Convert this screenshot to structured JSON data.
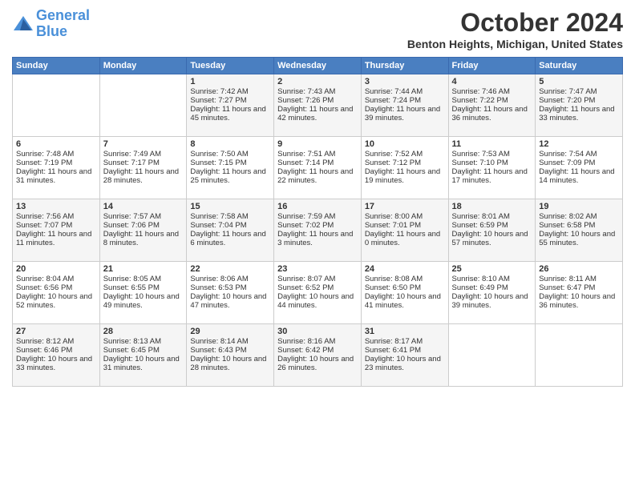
{
  "logo": {
    "line1": "General",
    "line2": "Blue"
  },
  "title": "October 2024",
  "location": "Benton Heights, Michigan, United States",
  "days_of_week": [
    "Sunday",
    "Monday",
    "Tuesday",
    "Wednesday",
    "Thursday",
    "Friday",
    "Saturday"
  ],
  "weeks": [
    [
      {
        "day": "",
        "sunrise": "",
        "sunset": "",
        "daylight": ""
      },
      {
        "day": "",
        "sunrise": "",
        "sunset": "",
        "daylight": ""
      },
      {
        "day": "1",
        "sunrise": "Sunrise: 7:42 AM",
        "sunset": "Sunset: 7:27 PM",
        "daylight": "Daylight: 11 hours and 45 minutes."
      },
      {
        "day": "2",
        "sunrise": "Sunrise: 7:43 AM",
        "sunset": "Sunset: 7:26 PM",
        "daylight": "Daylight: 11 hours and 42 minutes."
      },
      {
        "day": "3",
        "sunrise": "Sunrise: 7:44 AM",
        "sunset": "Sunset: 7:24 PM",
        "daylight": "Daylight: 11 hours and 39 minutes."
      },
      {
        "day": "4",
        "sunrise": "Sunrise: 7:46 AM",
        "sunset": "Sunset: 7:22 PM",
        "daylight": "Daylight: 11 hours and 36 minutes."
      },
      {
        "day": "5",
        "sunrise": "Sunrise: 7:47 AM",
        "sunset": "Sunset: 7:20 PM",
        "daylight": "Daylight: 11 hours and 33 minutes."
      }
    ],
    [
      {
        "day": "6",
        "sunrise": "Sunrise: 7:48 AM",
        "sunset": "Sunset: 7:19 PM",
        "daylight": "Daylight: 11 hours and 31 minutes."
      },
      {
        "day": "7",
        "sunrise": "Sunrise: 7:49 AM",
        "sunset": "Sunset: 7:17 PM",
        "daylight": "Daylight: 11 hours and 28 minutes."
      },
      {
        "day": "8",
        "sunrise": "Sunrise: 7:50 AM",
        "sunset": "Sunset: 7:15 PM",
        "daylight": "Daylight: 11 hours and 25 minutes."
      },
      {
        "day": "9",
        "sunrise": "Sunrise: 7:51 AM",
        "sunset": "Sunset: 7:14 PM",
        "daylight": "Daylight: 11 hours and 22 minutes."
      },
      {
        "day": "10",
        "sunrise": "Sunrise: 7:52 AM",
        "sunset": "Sunset: 7:12 PM",
        "daylight": "Daylight: 11 hours and 19 minutes."
      },
      {
        "day": "11",
        "sunrise": "Sunrise: 7:53 AM",
        "sunset": "Sunset: 7:10 PM",
        "daylight": "Daylight: 11 hours and 17 minutes."
      },
      {
        "day": "12",
        "sunrise": "Sunrise: 7:54 AM",
        "sunset": "Sunset: 7:09 PM",
        "daylight": "Daylight: 11 hours and 14 minutes."
      }
    ],
    [
      {
        "day": "13",
        "sunrise": "Sunrise: 7:56 AM",
        "sunset": "Sunset: 7:07 PM",
        "daylight": "Daylight: 11 hours and 11 minutes."
      },
      {
        "day": "14",
        "sunrise": "Sunrise: 7:57 AM",
        "sunset": "Sunset: 7:06 PM",
        "daylight": "Daylight: 11 hours and 8 minutes."
      },
      {
        "day": "15",
        "sunrise": "Sunrise: 7:58 AM",
        "sunset": "Sunset: 7:04 PM",
        "daylight": "Daylight: 11 hours and 6 minutes."
      },
      {
        "day": "16",
        "sunrise": "Sunrise: 7:59 AM",
        "sunset": "Sunset: 7:02 PM",
        "daylight": "Daylight: 11 hours and 3 minutes."
      },
      {
        "day": "17",
        "sunrise": "Sunrise: 8:00 AM",
        "sunset": "Sunset: 7:01 PM",
        "daylight": "Daylight: 11 hours and 0 minutes."
      },
      {
        "day": "18",
        "sunrise": "Sunrise: 8:01 AM",
        "sunset": "Sunset: 6:59 PM",
        "daylight": "Daylight: 10 hours and 57 minutes."
      },
      {
        "day": "19",
        "sunrise": "Sunrise: 8:02 AM",
        "sunset": "Sunset: 6:58 PM",
        "daylight": "Daylight: 10 hours and 55 minutes."
      }
    ],
    [
      {
        "day": "20",
        "sunrise": "Sunrise: 8:04 AM",
        "sunset": "Sunset: 6:56 PM",
        "daylight": "Daylight: 10 hours and 52 minutes."
      },
      {
        "day": "21",
        "sunrise": "Sunrise: 8:05 AM",
        "sunset": "Sunset: 6:55 PM",
        "daylight": "Daylight: 10 hours and 49 minutes."
      },
      {
        "day": "22",
        "sunrise": "Sunrise: 8:06 AM",
        "sunset": "Sunset: 6:53 PM",
        "daylight": "Daylight: 10 hours and 47 minutes."
      },
      {
        "day": "23",
        "sunrise": "Sunrise: 8:07 AM",
        "sunset": "Sunset: 6:52 PM",
        "daylight": "Daylight: 10 hours and 44 minutes."
      },
      {
        "day": "24",
        "sunrise": "Sunrise: 8:08 AM",
        "sunset": "Sunset: 6:50 PM",
        "daylight": "Daylight: 10 hours and 41 minutes."
      },
      {
        "day": "25",
        "sunrise": "Sunrise: 8:10 AM",
        "sunset": "Sunset: 6:49 PM",
        "daylight": "Daylight: 10 hours and 39 minutes."
      },
      {
        "day": "26",
        "sunrise": "Sunrise: 8:11 AM",
        "sunset": "Sunset: 6:47 PM",
        "daylight": "Daylight: 10 hours and 36 minutes."
      }
    ],
    [
      {
        "day": "27",
        "sunrise": "Sunrise: 8:12 AM",
        "sunset": "Sunset: 6:46 PM",
        "daylight": "Daylight: 10 hours and 33 minutes."
      },
      {
        "day": "28",
        "sunrise": "Sunrise: 8:13 AM",
        "sunset": "Sunset: 6:45 PM",
        "daylight": "Daylight: 10 hours and 31 minutes."
      },
      {
        "day": "29",
        "sunrise": "Sunrise: 8:14 AM",
        "sunset": "Sunset: 6:43 PM",
        "daylight": "Daylight: 10 hours and 28 minutes."
      },
      {
        "day": "30",
        "sunrise": "Sunrise: 8:16 AM",
        "sunset": "Sunset: 6:42 PM",
        "daylight": "Daylight: 10 hours and 26 minutes."
      },
      {
        "day": "31",
        "sunrise": "Sunrise: 8:17 AM",
        "sunset": "Sunset: 6:41 PM",
        "daylight": "Daylight: 10 hours and 23 minutes."
      },
      {
        "day": "",
        "sunrise": "",
        "sunset": "",
        "daylight": ""
      },
      {
        "day": "",
        "sunrise": "",
        "sunset": "",
        "daylight": ""
      }
    ]
  ]
}
